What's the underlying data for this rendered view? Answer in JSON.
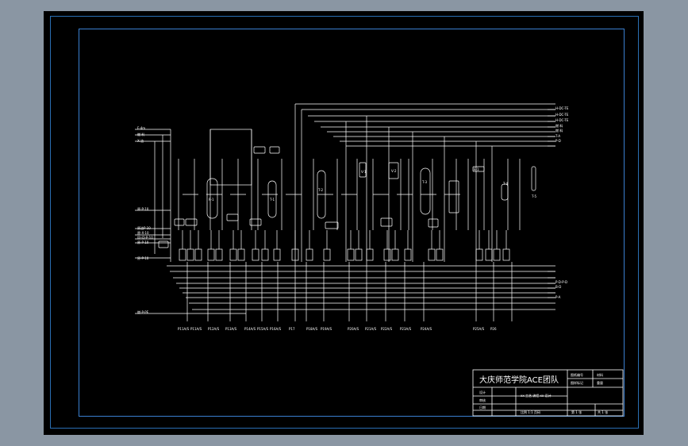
{
  "title_block": {
    "school": "大庆师范学院ACE团队",
    "drawing_name": "xx 工艺 流程 xx 设计",
    "scale_row": "比例 1:1 页码",
    "page_row": "第 1 张",
    "sheet_row": "共 1 张",
    "rows": [
      "设计",
      "审核",
      "日期"
    ],
    "top_right": [
      "图纸编号",
      "材料",
      "图样标记",
      "重量"
    ]
  },
  "left_inputs": [
    "F-4m",
    "燃 料",
    "X-油",
    "原-P-10",
    "原油P-10",
    "原-X-10",
    "回-回-P-10",
    "原-P-10",
    "原-P-10",
    "燃-P-PE"
  ],
  "right_outputs": [
    "H-DC-TE",
    "H-DC-TE",
    "H-DC-TE",
    "燃 料",
    "燃 料",
    "T-A",
    "P-D",
    "P-D-P-D",
    "B-D",
    "P-A"
  ],
  "equipment_labels": [
    "R-1",
    "T-1",
    "T-2",
    "T-3",
    "T-4",
    "T-5",
    "V-1",
    "V-2",
    "E-1"
  ],
  "bottom_tags": [
    "P11A/S",
    "P11A/S",
    "P12A/S",
    "P13A/S",
    "P14A/S",
    "P15A/S",
    "P16A/S",
    "P17",
    "P18A/S",
    "P19A/S",
    "P20A/S",
    "P21A/S",
    "P22A/S",
    "P23A/S",
    "P24A/S",
    "P25A/S",
    "P26"
  ],
  "colors": {
    "sheet": "#000000",
    "line": "#ffffff",
    "frame": "#2a6fb3",
    "background": "#8a96a3"
  }
}
